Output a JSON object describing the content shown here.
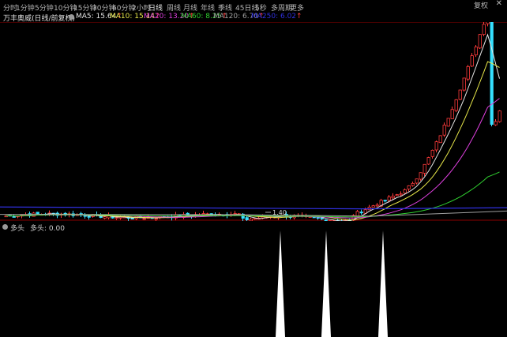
{
  "toolbar": {
    "periods": [
      "分时",
      "1分钟",
      "5分钟",
      "10分钟",
      "15分钟",
      "30分钟",
      "60分钟",
      "2小时",
      "日线",
      "周线",
      "月线",
      "年线",
      "季线",
      "45日线",
      "5秒",
      "多周期",
      "更多"
    ],
    "active_period": "日线",
    "restore_label": "复权",
    "close_label": "✕"
  },
  "main_panel": {
    "title": "万丰奥威(日线/前复权)",
    "ma_items": [
      {
        "label": "MA5: 15.64",
        "color": "#e6e6e6"
      },
      {
        "label": "MA10: 15.14",
        "color": "#e8e84a"
      },
      {
        "label": "MA20: 13.20",
        "color": "#e040e0"
      },
      {
        "label": "MA60: 8.25",
        "color": "#30d030"
      },
      {
        "label": "MA120: 6.70",
        "color": "#a0a0a0"
      },
      {
        "label": "MA250: 6.02",
        "color": "#3030e0"
      }
    ],
    "up_arrow": "↑",
    "low_marker": "1.40"
  },
  "sub_panel": {
    "title": "多头",
    "value_label": "多头: 0.00"
  },
  "colors": {
    "up": "#ff3b3b",
    "down": "#35e0ff",
    "background": "#000000",
    "grid": "#8a0000",
    "arrow": "#ff4040"
  }
}
